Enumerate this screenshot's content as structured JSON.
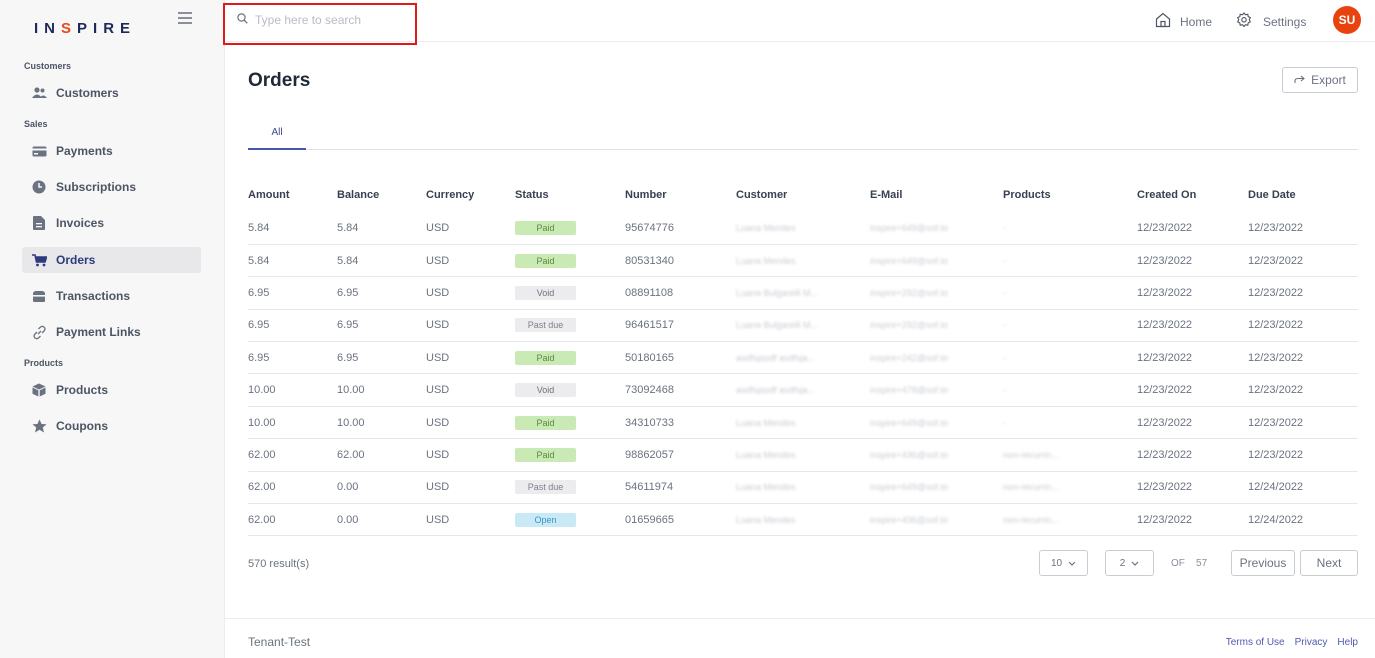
{
  "app": {
    "logo_pre": "IN",
    "logo_dot": "S",
    "logo_post": "PIRE"
  },
  "search": {
    "placeholder": "Type here to search"
  },
  "topnav": {
    "home": "Home",
    "settings": "Settings",
    "avatar": "SU"
  },
  "sidebar": {
    "sections": [
      "Customers",
      "Sales",
      "Products"
    ],
    "items": [
      {
        "label": "Customers",
        "icon": "users-icon"
      },
      {
        "label": "Payments",
        "icon": "credit-card-icon"
      },
      {
        "label": "Subscriptions",
        "icon": "clock-icon"
      },
      {
        "label": "Invoices",
        "icon": "document-icon"
      },
      {
        "label": "Orders",
        "icon": "cart-icon",
        "active": true
      },
      {
        "label": "Transactions",
        "icon": "wallet-icon"
      },
      {
        "label": "Payment Links",
        "icon": "link-icon"
      },
      {
        "label": "Products",
        "icon": "box-icon"
      },
      {
        "label": "Coupons",
        "icon": "star-icon"
      }
    ]
  },
  "main": {
    "title": "Orders",
    "export_label": "Export",
    "tabs": [
      "All"
    ],
    "columns": [
      "Amount",
      "Balance",
      "Currency",
      "Status",
      "Number",
      "Customer",
      "E-Mail",
      "Products",
      "Created On",
      "Due Date"
    ],
    "rows": [
      [
        "5.84",
        "5.84",
        "USD",
        "Paid",
        "95674776",
        "Luana Mendes",
        "inspire+649@sof.to",
        "-",
        "12/23/2022",
        "12/23/2022"
      ],
      [
        "5.84",
        "5.84",
        "USD",
        "Paid",
        "80531340",
        "Luana Mendes",
        "inspire+649@sof.to",
        "-",
        "12/23/2022",
        "12/23/2022"
      ],
      [
        "6.95",
        "6.95",
        "USD",
        "Void",
        "08891108",
        "Luana Bulgarelli M...",
        "inspire+292@sof.to",
        "-",
        "12/23/2022",
        "12/23/2022"
      ],
      [
        "6.95",
        "6.95",
        "USD",
        "Past due",
        "96461517",
        "Luana Bulgarelli M...",
        "inspire+292@sof.to",
        "-",
        "12/23/2022",
        "12/23/2022"
      ],
      [
        "6.95",
        "6.95",
        "USD",
        "Paid",
        "50180165",
        "asdfsjasdf asdfsja...",
        "inspire+242@sof.to",
        "-",
        "12/23/2022",
        "12/23/2022"
      ],
      [
        "10.00",
        "10.00",
        "USD",
        "Void",
        "73092468",
        "asdfsjasdf asdfsja...",
        "inspire+478@sof.to",
        "-",
        "12/23/2022",
        "12/23/2022"
      ],
      [
        "10.00",
        "10.00",
        "USD",
        "Paid",
        "34310733",
        "Luana Mendes",
        "inspire+649@sof.to",
        "-",
        "12/23/2022",
        "12/23/2022"
      ],
      [
        "62.00",
        "62.00",
        "USD",
        "Paid",
        "98862057",
        "Luana Mendes",
        "inspire+436@sof.to",
        "non-recurrin...",
        "12/23/2022",
        "12/23/2022"
      ],
      [
        "62.00",
        "0.00",
        "USD",
        "Past due",
        "54611974",
        "Luana Mendes",
        "inspire+649@sof.to",
        "non-recurrin...",
        "12/23/2022",
        "12/24/2022"
      ],
      [
        "62.00",
        "0.00",
        "USD",
        "Open",
        "01659665",
        "Luana Mendes",
        "inspire+436@sof.to",
        "non-recurrin...",
        "12/23/2022",
        "12/24/2022"
      ]
    ],
    "results": "570 result(s)",
    "page_size": "10",
    "current_page": "2",
    "of_label": "OF",
    "total_pages": "57",
    "previous_label": "Previous",
    "next_label": "Next"
  },
  "footer": {
    "tenant": "Tenant-Test",
    "links": [
      "Terms of Use",
      "Privacy",
      "Help"
    ]
  },
  "colors": {
    "accent": "#4857a6",
    "avatar": "#e8420f",
    "highlight": "#dd1b1b",
    "paid": "#c9eab4",
    "open": "#c9e9f7"
  }
}
